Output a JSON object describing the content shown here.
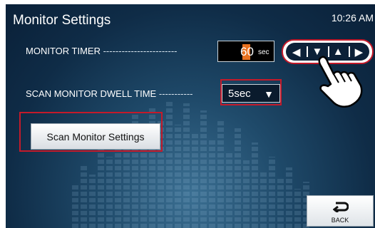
{
  "header": {
    "title": "Monitor Settings",
    "time": "10:26 AM"
  },
  "monitor_timer": {
    "label": "MONITOR TIMER",
    "dashes": "------------------------",
    "value": "60",
    "unit": "sec",
    "buttons": {
      "left": "◀",
      "down": "▼",
      "up": "▲",
      "right": "▶"
    }
  },
  "dwell_time": {
    "label": "SCAN MONITOR DWELL TIME",
    "dashes": "-----------",
    "selected": "5sec",
    "caret": "▼"
  },
  "scan_button": {
    "label": "Scan Monitor Settings"
  },
  "back_button": {
    "label": "BACK"
  },
  "colors": {
    "highlight_red": "#c41a2a",
    "value_accent": "#e8711f",
    "background": "#1f4a6a"
  },
  "icons": [
    "left-arrow-icon",
    "down-arrow-icon",
    "up-arrow-icon",
    "right-arrow-icon",
    "pointing-hand-icon",
    "back-arrow-icon",
    "dropdown-caret-icon"
  ]
}
